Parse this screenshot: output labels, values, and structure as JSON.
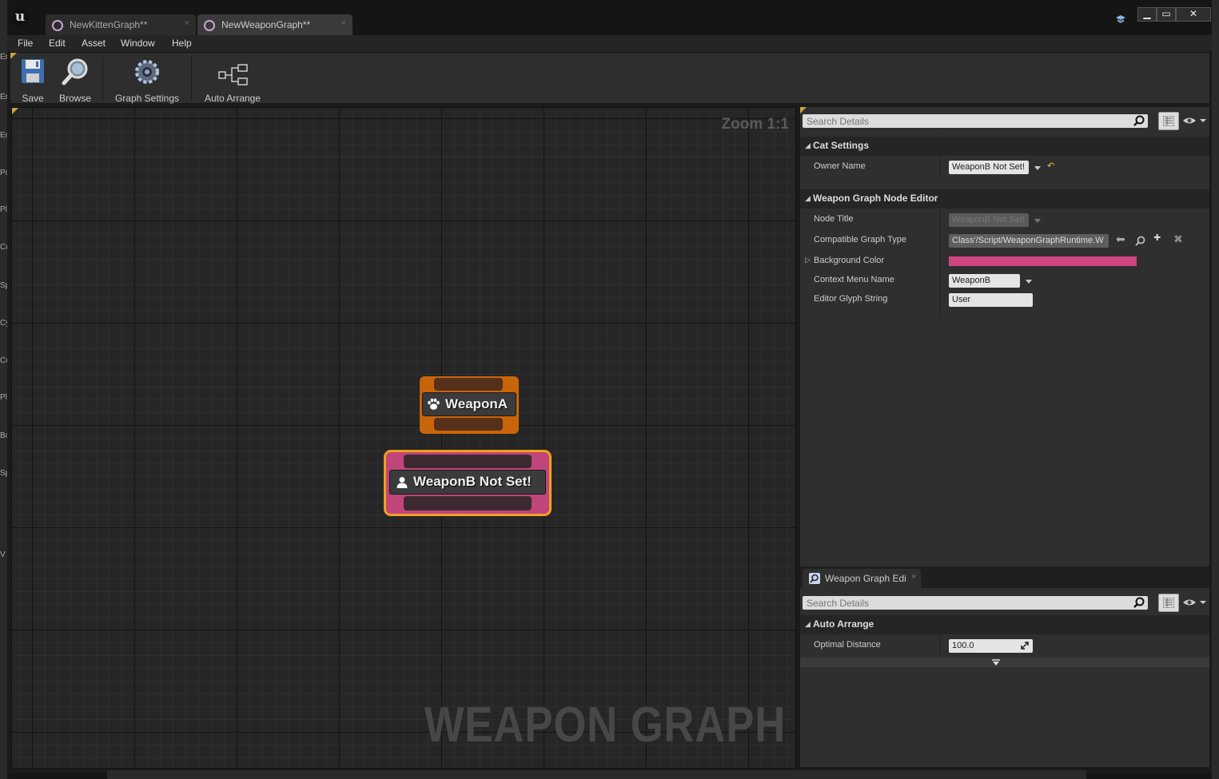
{
  "window": {
    "tabs": [
      {
        "label": "NewKittenGraph**",
        "close": "×"
      },
      {
        "label": "NewWeaponGraph**",
        "close": "×"
      }
    ],
    "controls": {
      "minimize": "▁",
      "maximize": "▭",
      "close": "✕"
    }
  },
  "menu": [
    "File",
    "Edit",
    "Asset",
    "Window",
    "Help"
  ],
  "toolbar": {
    "save": "Save",
    "browse": "Browse",
    "graph_settings": "Graph Settings",
    "auto_arrange": "Auto Arrange"
  },
  "graph": {
    "zoom": "Zoom 1:1",
    "watermark": "WEAPON GRAPH",
    "nodes": [
      {
        "title": "WeaponA",
        "icon": "paw-icon",
        "color": "#c8650a"
      },
      {
        "title": "WeaponB Not Set!",
        "icon": "user-icon",
        "color": "#c0457a",
        "selected_border": "#f0a020"
      }
    ]
  },
  "details": {
    "search_placeholder": "Search Details",
    "sections": {
      "cat_settings": {
        "title": "Cat Settings",
        "owner_name_label": "Owner Name",
        "owner_name_value": "WeaponB Not Set!"
      },
      "node_editor": {
        "title": "Weapon Graph Node Editor",
        "node_title_label": "Node Title",
        "node_title_value": "WeaponB Not Set!",
        "compatible_label": "Compatible Graph Type",
        "compatible_value": "Class'/Script/WeaponGraphRuntime.W",
        "bg_color_label": "Background Color",
        "bg_color_value": "#d0457f",
        "context_menu_label": "Context Menu Name",
        "context_menu_value": "WeaponB",
        "glyph_label": "Editor Glyph String",
        "glyph_value": "User"
      }
    }
  },
  "details2": {
    "tab_label": "Weapon Graph Edi",
    "tab_close": "×",
    "search_placeholder": "Search Details",
    "section_title": "Auto Arrange",
    "optimal_label": "Optimal Distance",
    "optimal_value": "100.0"
  },
  "left_strip": [
    "Er",
    "Er",
    "Er",
    "Po",
    "Pl",
    "Cu",
    "Sp",
    "Cy",
    "Co",
    "Pl",
    "Bo",
    "Sp",
    "V"
  ]
}
